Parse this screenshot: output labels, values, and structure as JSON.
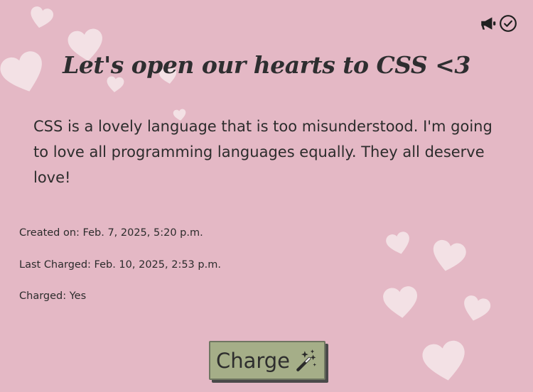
{
  "header": {
    "icons": [
      "megaphone-icon",
      "check-circle-icon"
    ]
  },
  "post": {
    "title": "Let's open our hearts to CSS <3",
    "body": "CSS is a lovely language that is too misunderstood. I'm going to love all programming languages equally. They all deserve love!"
  },
  "meta": {
    "created": "Created on: Feb. 7, 2025, 5:20 p.m.",
    "last_charged": "Last Charged: Feb. 10, 2025, 2:53 p.m.",
    "charged": "Charged: Yes"
  },
  "actions": {
    "charge_label": "Charge",
    "charge_icon": "magic-wand-icon"
  },
  "colors": {
    "background": "#e4b8c5",
    "heart": "#f3e1e5",
    "button": "#a5ae88",
    "text": "#2c2c2c"
  }
}
